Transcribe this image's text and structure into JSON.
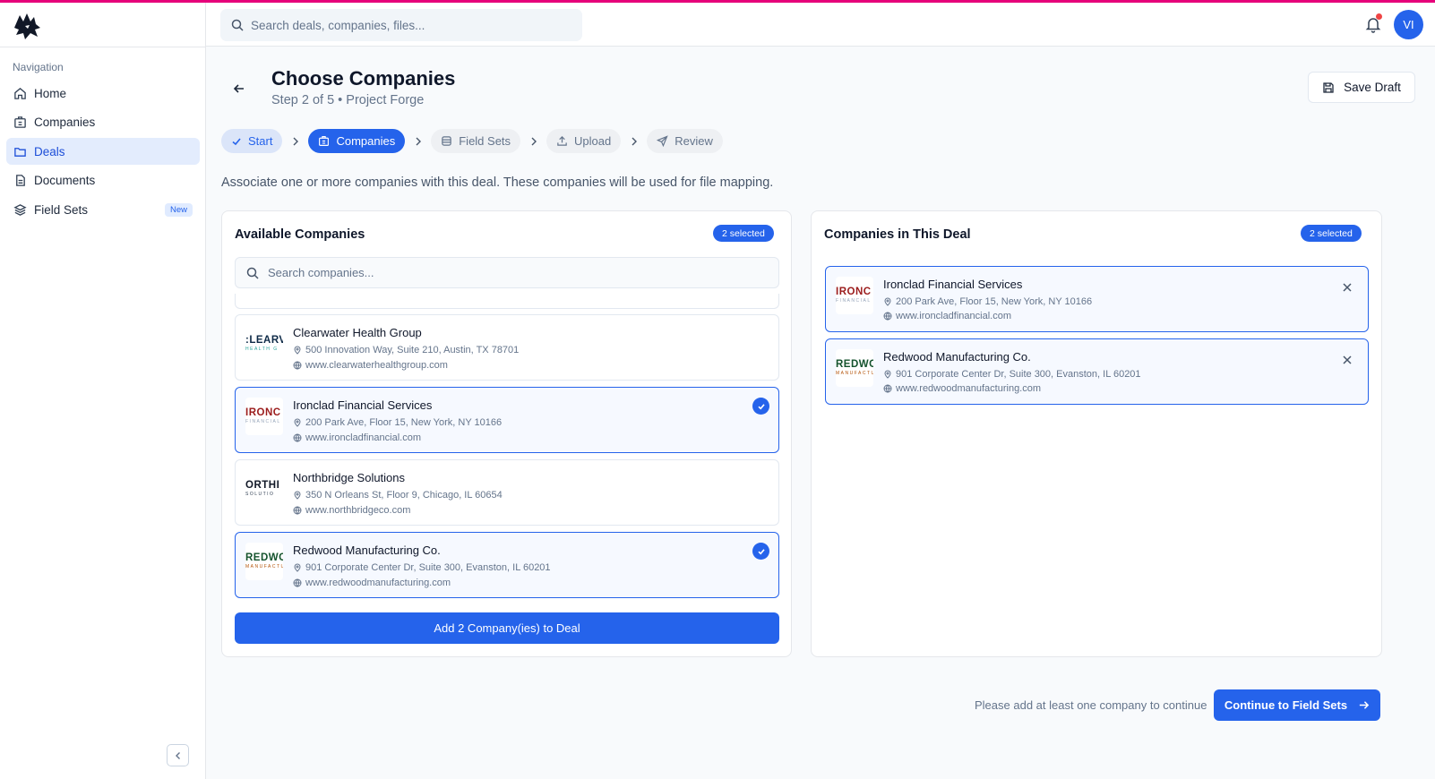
{
  "app": {
    "accent_color": "#2563eb",
    "top_stripe_color": "#e6007a"
  },
  "topbar": {
    "search_placeholder": "Search deals, companies, files...",
    "avatar_initials": "VI"
  },
  "sidebar": {
    "heading": "Navigation",
    "items": [
      {
        "label": "Home",
        "icon": "home-icon"
      },
      {
        "label": "Companies",
        "icon": "building-icon"
      },
      {
        "label": "Deals",
        "icon": "folder-icon",
        "active": true
      },
      {
        "label": "Documents",
        "icon": "document-icon"
      },
      {
        "label": "Field Sets",
        "icon": "layers-icon",
        "badge": "New"
      }
    ]
  },
  "page": {
    "title": "Choose Companies",
    "subtitle": "Step 2 of 5 • Project Forge",
    "save_draft_label": "Save Draft",
    "intro": "Associate one or more companies with this deal. These companies will be used for file mapping.",
    "steps": [
      {
        "label": "Start",
        "state": "done"
      },
      {
        "label": "Companies",
        "state": "current"
      },
      {
        "label": "Field Sets",
        "state": "future"
      },
      {
        "label": "Upload",
        "state": "future"
      },
      {
        "label": "Review",
        "state": "future"
      }
    ]
  },
  "available": {
    "title": "Available Companies",
    "selected_badge": "2 selected",
    "search_placeholder": "Search companies...",
    "companies": [
      {
        "name": "Clearwater Health Group",
        "address": "500 Innovation Way, Suite 210, Austin, TX 78701",
        "website": "www.clearwaterhealthgroup.com",
        "logo_text": ":LEARV",
        "logo_sub": "HEALTH G",
        "logo_color": "#0e2a47",
        "selected": false
      },
      {
        "name": "Ironclad Financial Services",
        "address": "200 Park Ave, Floor 15, New York, NY 10166",
        "website": "www.ironcladfinancial.com",
        "logo_text": "IRONC",
        "logo_sub": "FINANCIAL S",
        "logo_color": "#9b1c1c",
        "selected": true
      },
      {
        "name": "Northbridge Solutions",
        "address": "350 N Orleans St, Floor 9, Chicago, IL 60654",
        "website": "www.northbridgeco.com",
        "logo_text": "ORTHI",
        "logo_sub": "SOLUTIO",
        "logo_color": "#111827",
        "selected": false
      },
      {
        "name": "Redwood Manufacturing Co.",
        "address": "901 Corporate Center Dr, Suite 300, Evanston, IL 60201",
        "website": "www.redwoodmanufacturing.com",
        "logo_text": "REDWC",
        "logo_sub": "MANUFACTU",
        "logo_color": "#14532d",
        "selected": true
      }
    ],
    "add_button_label": "Add 2 Company(ies) to Deal"
  },
  "in_deal": {
    "title": "Companies in This Deal",
    "selected_badge": "2 selected",
    "companies": [
      {
        "name": "Ironclad Financial Services",
        "address": "200 Park Ave, Floor 15, New York, NY 10166",
        "website": "www.ironcladfinancial.com",
        "logo_text": "IRONC",
        "logo_sub": "FINANCIAL S",
        "logo_color": "#9b1c1c"
      },
      {
        "name": "Redwood Manufacturing Co.",
        "address": "901 Corporate Center Dr, Suite 300, Evanston, IL 60201",
        "website": "www.redwoodmanufacturing.com",
        "logo_text": "REDWC",
        "logo_sub": "MANUFACTU",
        "logo_color": "#14532d"
      }
    ]
  },
  "footer": {
    "message": "Please add at least one company to continue",
    "continue_label": "Continue to Field Sets"
  }
}
